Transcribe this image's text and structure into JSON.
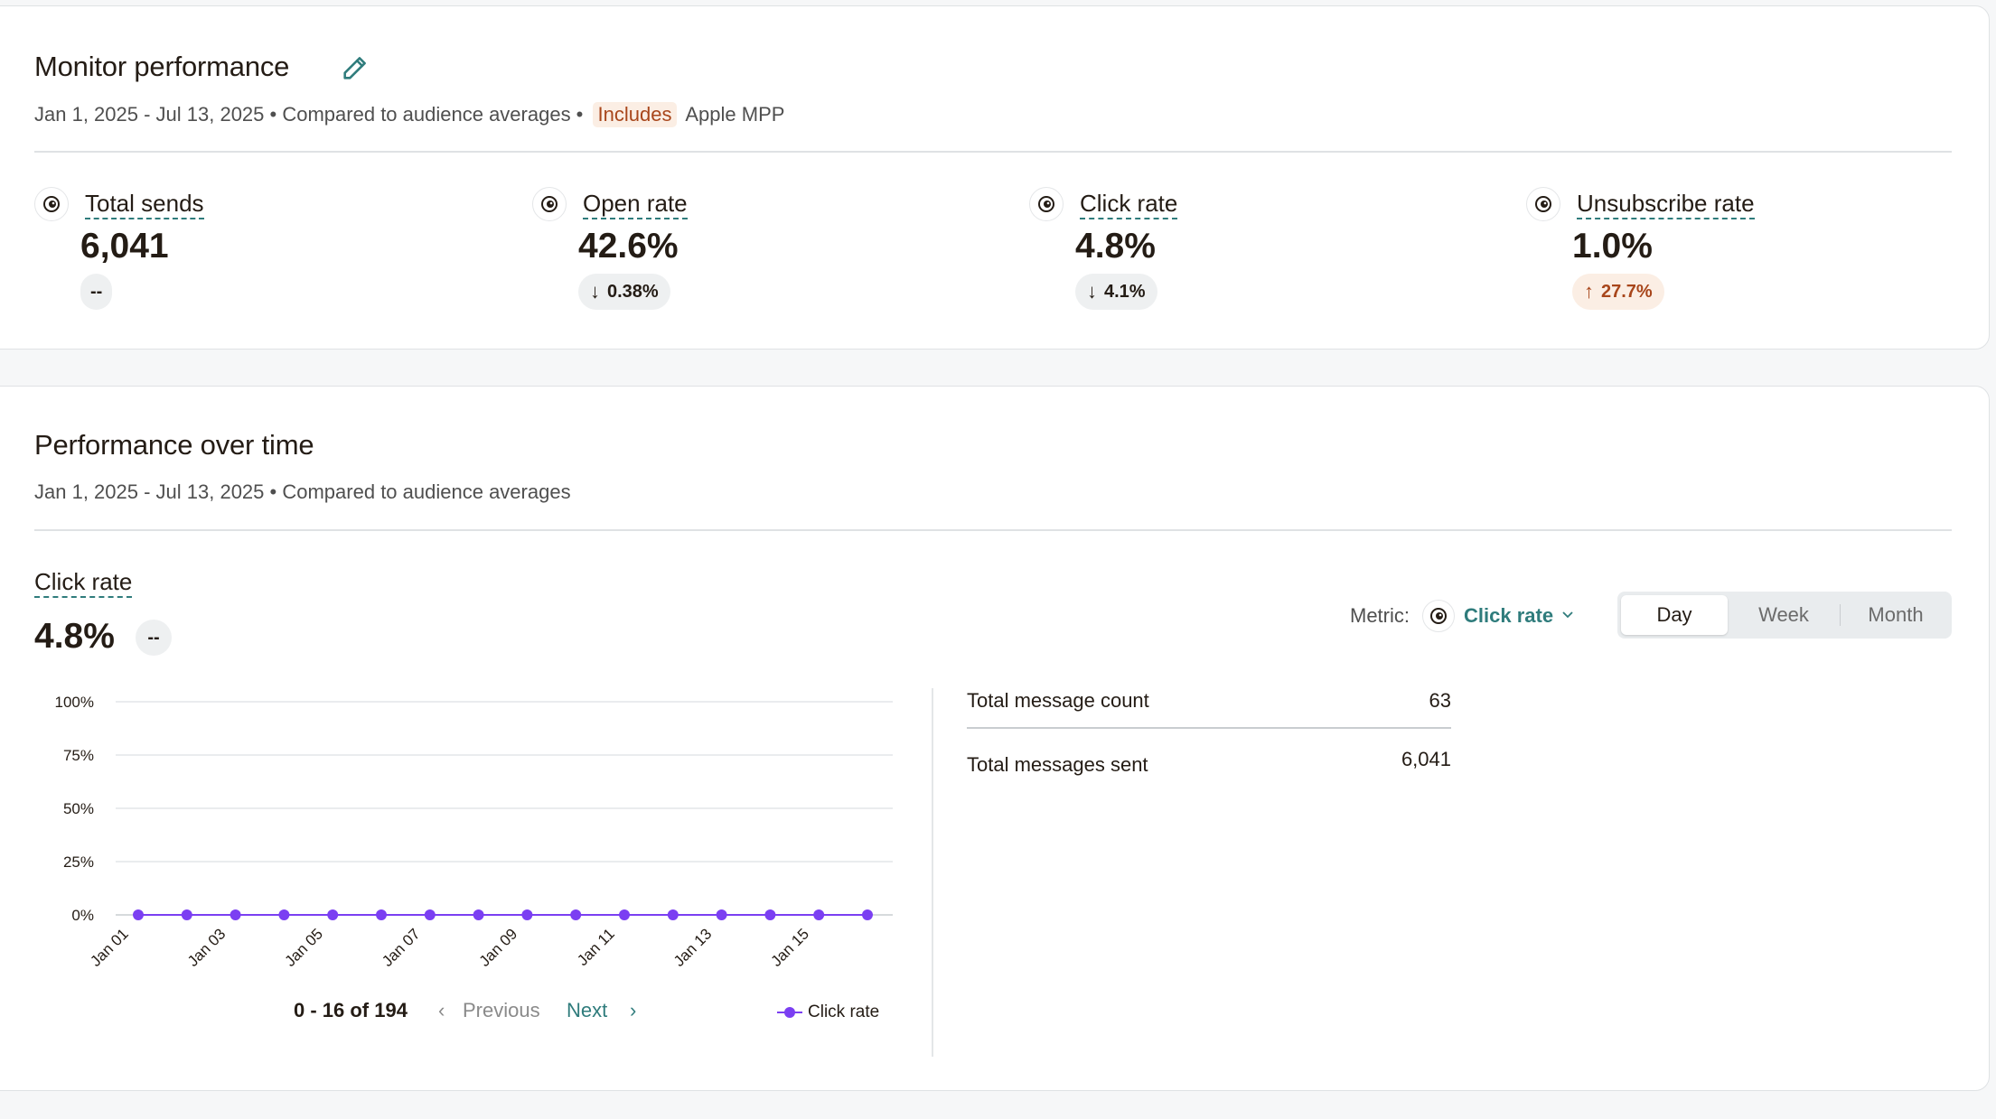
{
  "monitor": {
    "title": "Monitor performance",
    "date_range": "Jan 1, 2025 - Jul 13, 2025",
    "compared": "• Compared to audience averages •",
    "includes_badge": "Includes",
    "includes_text": "Apple MPP",
    "metrics": [
      {
        "label": "Total sends",
        "value": "6,041",
        "badge": "--",
        "trend": "none"
      },
      {
        "label": "Open rate",
        "value": "42.6%",
        "badge": "0.38%",
        "trend": "down"
      },
      {
        "label": "Click rate",
        "value": "4.8%",
        "badge": "4.1%",
        "trend": "down"
      },
      {
        "label": "Unsubscribe rate",
        "value": "1.0%",
        "badge": "27.7%",
        "trend": "up-bad"
      }
    ]
  },
  "performance": {
    "title": "Performance over time",
    "date_range": "Jan 1, 2025 - Jul 13, 2025",
    "compared": "• Compared to audience averages",
    "selected_metric_label": "Click rate",
    "selected_metric_value": "4.8%",
    "selected_metric_badge": "--",
    "metric_selector": {
      "label": "Metric:",
      "value": "Click rate"
    },
    "granularity": {
      "options": [
        "Day",
        "Week",
        "Month"
      ],
      "selected": "Day"
    },
    "pagination": {
      "range": "0 - 16 of 194",
      "previous": "Previous",
      "next": "Next"
    },
    "legend": "Click rate",
    "stats": [
      {
        "label": "Total message count",
        "value": "63"
      },
      {
        "label": "Total messages sent",
        "value": "6,041"
      }
    ]
  },
  "icons": {
    "metric_icon": "mailchimp-freddie-icon",
    "edit": "pencil-icon",
    "down": "arrow-down-icon",
    "up": "arrow-up-icon"
  },
  "colors": {
    "accent": "#2f7c7c",
    "series": "#7b3ff2",
    "bad_bg": "#fbeee4",
    "bad_fg": "#a8461b"
  },
  "chart_data": {
    "type": "line",
    "x": [
      "Jan 01",
      "Jan 02",
      "Jan 03",
      "Jan 04",
      "Jan 05",
      "Jan 06",
      "Jan 07",
      "Jan 08",
      "Jan 09",
      "Jan 10",
      "Jan 11",
      "Jan 12",
      "Jan 13",
      "Jan 14",
      "Jan 15",
      "Jan 16"
    ],
    "xtick_labels": [
      "Jan 01",
      "Jan 03",
      "Jan 05",
      "Jan 07",
      "Jan 09",
      "Jan 11",
      "Jan 13",
      "Jan 15"
    ],
    "series": [
      {
        "name": "Click rate",
        "values": [
          0,
          0,
          0,
          0,
          0,
          0,
          0,
          0,
          0,
          0,
          0,
          0,
          0,
          0,
          0,
          0
        ]
      }
    ],
    "ylim": [
      0,
      100
    ],
    "yticks": [
      "0%",
      "25%",
      "50%",
      "75%",
      "100%"
    ],
    "ytick_values": [
      0,
      25,
      50,
      75,
      100
    ],
    "grid": true,
    "legend_position": "bottom-right"
  }
}
